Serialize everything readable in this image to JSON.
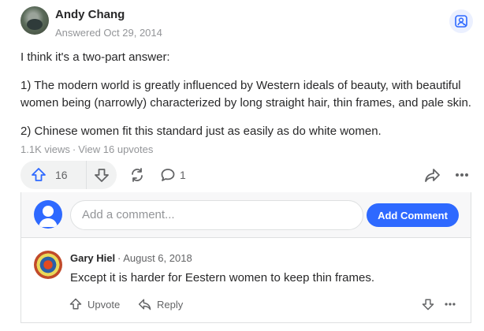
{
  "answer_header": {
    "author": "Andy Chang",
    "answered": "Answered Oct 29, 2014"
  },
  "answer": {
    "paragraphs": [
      "I think it's a two-part answer:",
      "1) The modern world is greatly influenced by Western ideals of beauty, with beautiful women being (narrowly) characterized by long straight hair, thin frames, and pale skin.",
      "2) Chinese women fit this standard just as easily as do white women."
    ]
  },
  "stats": {
    "views": "1.1K views",
    "separator": "·",
    "upvotes_link": "View 16 upvotes"
  },
  "actions": {
    "upvote_count": "16",
    "comment_count": "1"
  },
  "comments": {
    "input_placeholder": "Add a comment...",
    "add_comment_label": "Add Comment",
    "items": [
      {
        "author": "Gary Hiel",
        "date": "· August 6, 2018",
        "text": "Except it is harder for Eestern women to keep thin frames.",
        "upvote_label": "Upvote",
        "reply_label": "Reply"
      }
    ]
  },
  "icons": {
    "upvote": "arrow-up-icon",
    "downvote": "arrow-down-icon",
    "share": "repost-icon",
    "comment": "speech-bubble-icon",
    "forward": "share-arrow-icon",
    "more": "more-dots-icon",
    "profile": "user-badge-icon"
  },
  "colors": {
    "accent": "#2e69ff",
    "text": "#282829",
    "muted": "#939598"
  }
}
